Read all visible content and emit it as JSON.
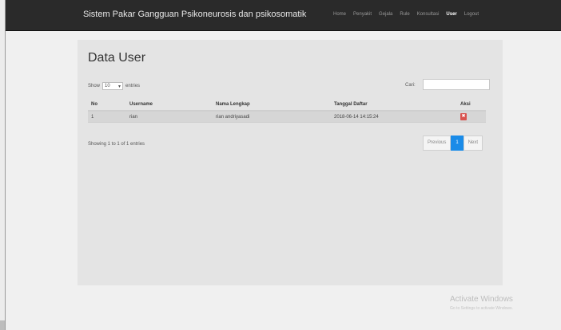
{
  "navbar": {
    "brand": "Sistem Pakar Gangguan Psikoneurosis dan psikosomatik",
    "menu": [
      "Home",
      "Penyakit",
      "Gejala",
      "Rule",
      "Konsultasi",
      "User",
      "Logout"
    ],
    "active_index": 5
  },
  "page": {
    "title": "Data User",
    "show_label": "Show",
    "entries_value": "10",
    "entries_label": "entries",
    "search_label": "Cari:"
  },
  "table": {
    "headers": [
      "No",
      "Username",
      "Nama Lengkap",
      "Tanggal Daftar",
      "Aksi"
    ],
    "rows": [
      [
        "1",
        "rian",
        "rian andriyasadi",
        "2018-06-14 14:15:24"
      ]
    ]
  },
  "footer": {
    "info": "Showing 1 to 1 of 1 entries",
    "previous": "Previous",
    "page": "1",
    "next": "Next"
  },
  "watermark": {
    "line1": "Activate Windows",
    "line2": "Go to Settings to activate Windows."
  }
}
